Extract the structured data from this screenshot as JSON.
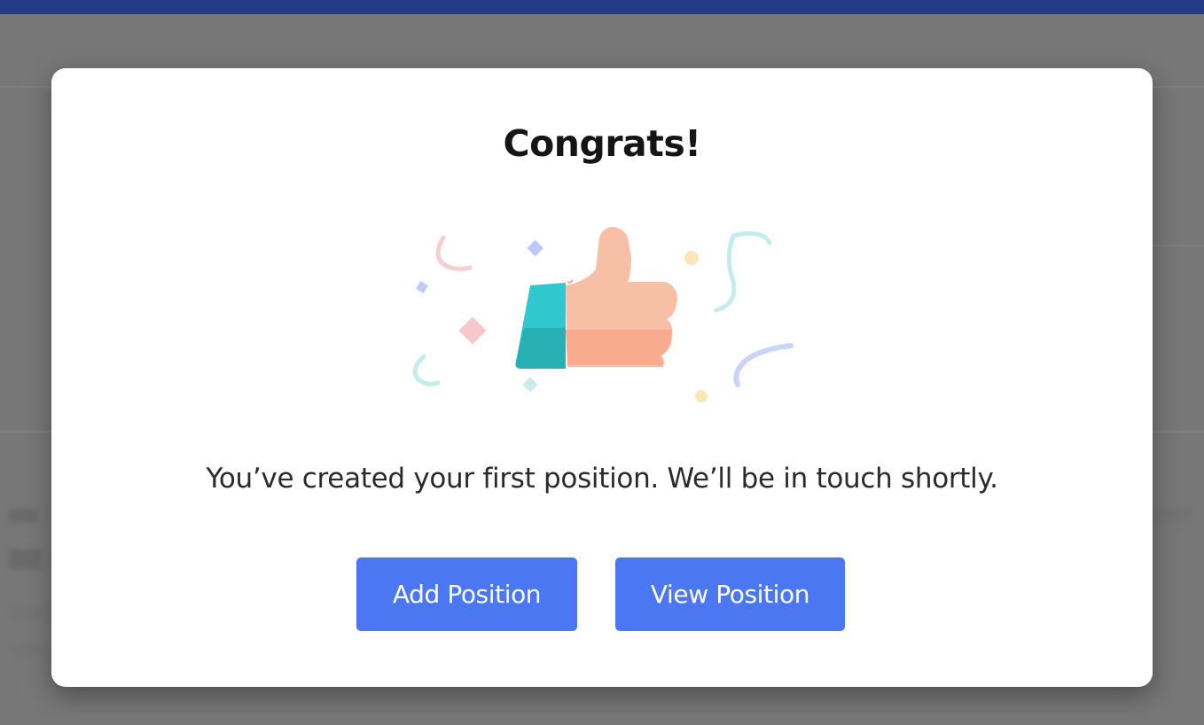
{
  "dialog": {
    "title": "Congrats!",
    "message": "You’ve created your first position. We’ll be in touch shortly.",
    "illustration": "thumbs-up-confetti-icon",
    "buttons": {
      "add_position": "Add Position",
      "view_position": "View Position"
    }
  },
  "colors": {
    "top_bar": "#233a86",
    "overlay": "#777777",
    "button": "#4b78f2",
    "hand": "#f7bca4",
    "sleeve": "#2fc8cf"
  }
}
